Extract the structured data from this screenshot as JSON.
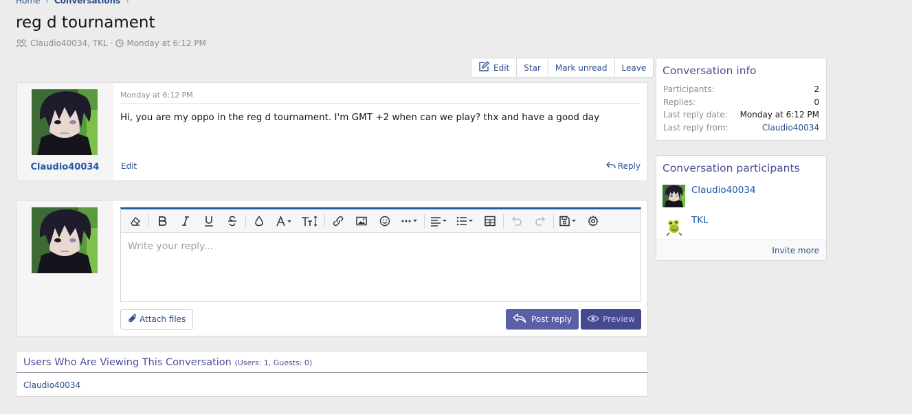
{
  "breadcrumbs": [
    "Home",
    "Conversations"
  ],
  "title": "reg d tournament",
  "meta": {
    "participants": "Claudio40034, TKL",
    "separator": "·",
    "time": "Monday at 6:12 PM"
  },
  "actions": {
    "edit": "Edit",
    "star": "Star",
    "mark_unread": "Mark unread",
    "leave": "Leave"
  },
  "message": {
    "author": "Claudio40034",
    "date": "Monday at 6:12 PM",
    "body": "Hi, you are my oppo in the reg d tournament. I'm GMT +2 when can we play? thx and have a good day",
    "edit": "Edit",
    "reply": "Reply"
  },
  "editor": {
    "placeholder": "Write your reply...",
    "attach": "Attach files",
    "post": "Post reply",
    "preview": "Preview",
    "toolbar_icons": [
      "eraser-icon",
      "bold-icon",
      "italic-icon",
      "underline-icon",
      "strike-icon",
      "color-icon",
      "font-icon",
      "size-icon",
      "link-icon",
      "image-icon",
      "smiley-icon",
      "more-icon",
      "align-icon",
      "list-icon",
      "table-icon",
      "undo-icon",
      "redo-icon",
      "drafts-icon",
      "settings-icon"
    ]
  },
  "viewers": {
    "title": "Users Who Are Viewing This Conversation",
    "counts": "(Users: 1, Guests: 0)",
    "names": "Claudio40034"
  },
  "info": {
    "title": "Conversation info",
    "rows": [
      {
        "k": "Participants:",
        "v": "2"
      },
      {
        "k": "Replies:",
        "v": "0"
      },
      {
        "k": "Last reply date:",
        "v": "Monday at 6:12 PM"
      },
      {
        "k": "Last reply from:",
        "v": "Claudio40034"
      }
    ]
  },
  "participants": {
    "title": "Conversation participants",
    "people": [
      {
        "name": "Claudio40034"
      },
      {
        "name": "TKL"
      }
    ],
    "invite": "Invite more"
  },
  "colors": {
    "accent": "#2456a8",
    "link": "#2b4e8c",
    "button": "#5b5fa8",
    "heading": "#4a4e95"
  }
}
